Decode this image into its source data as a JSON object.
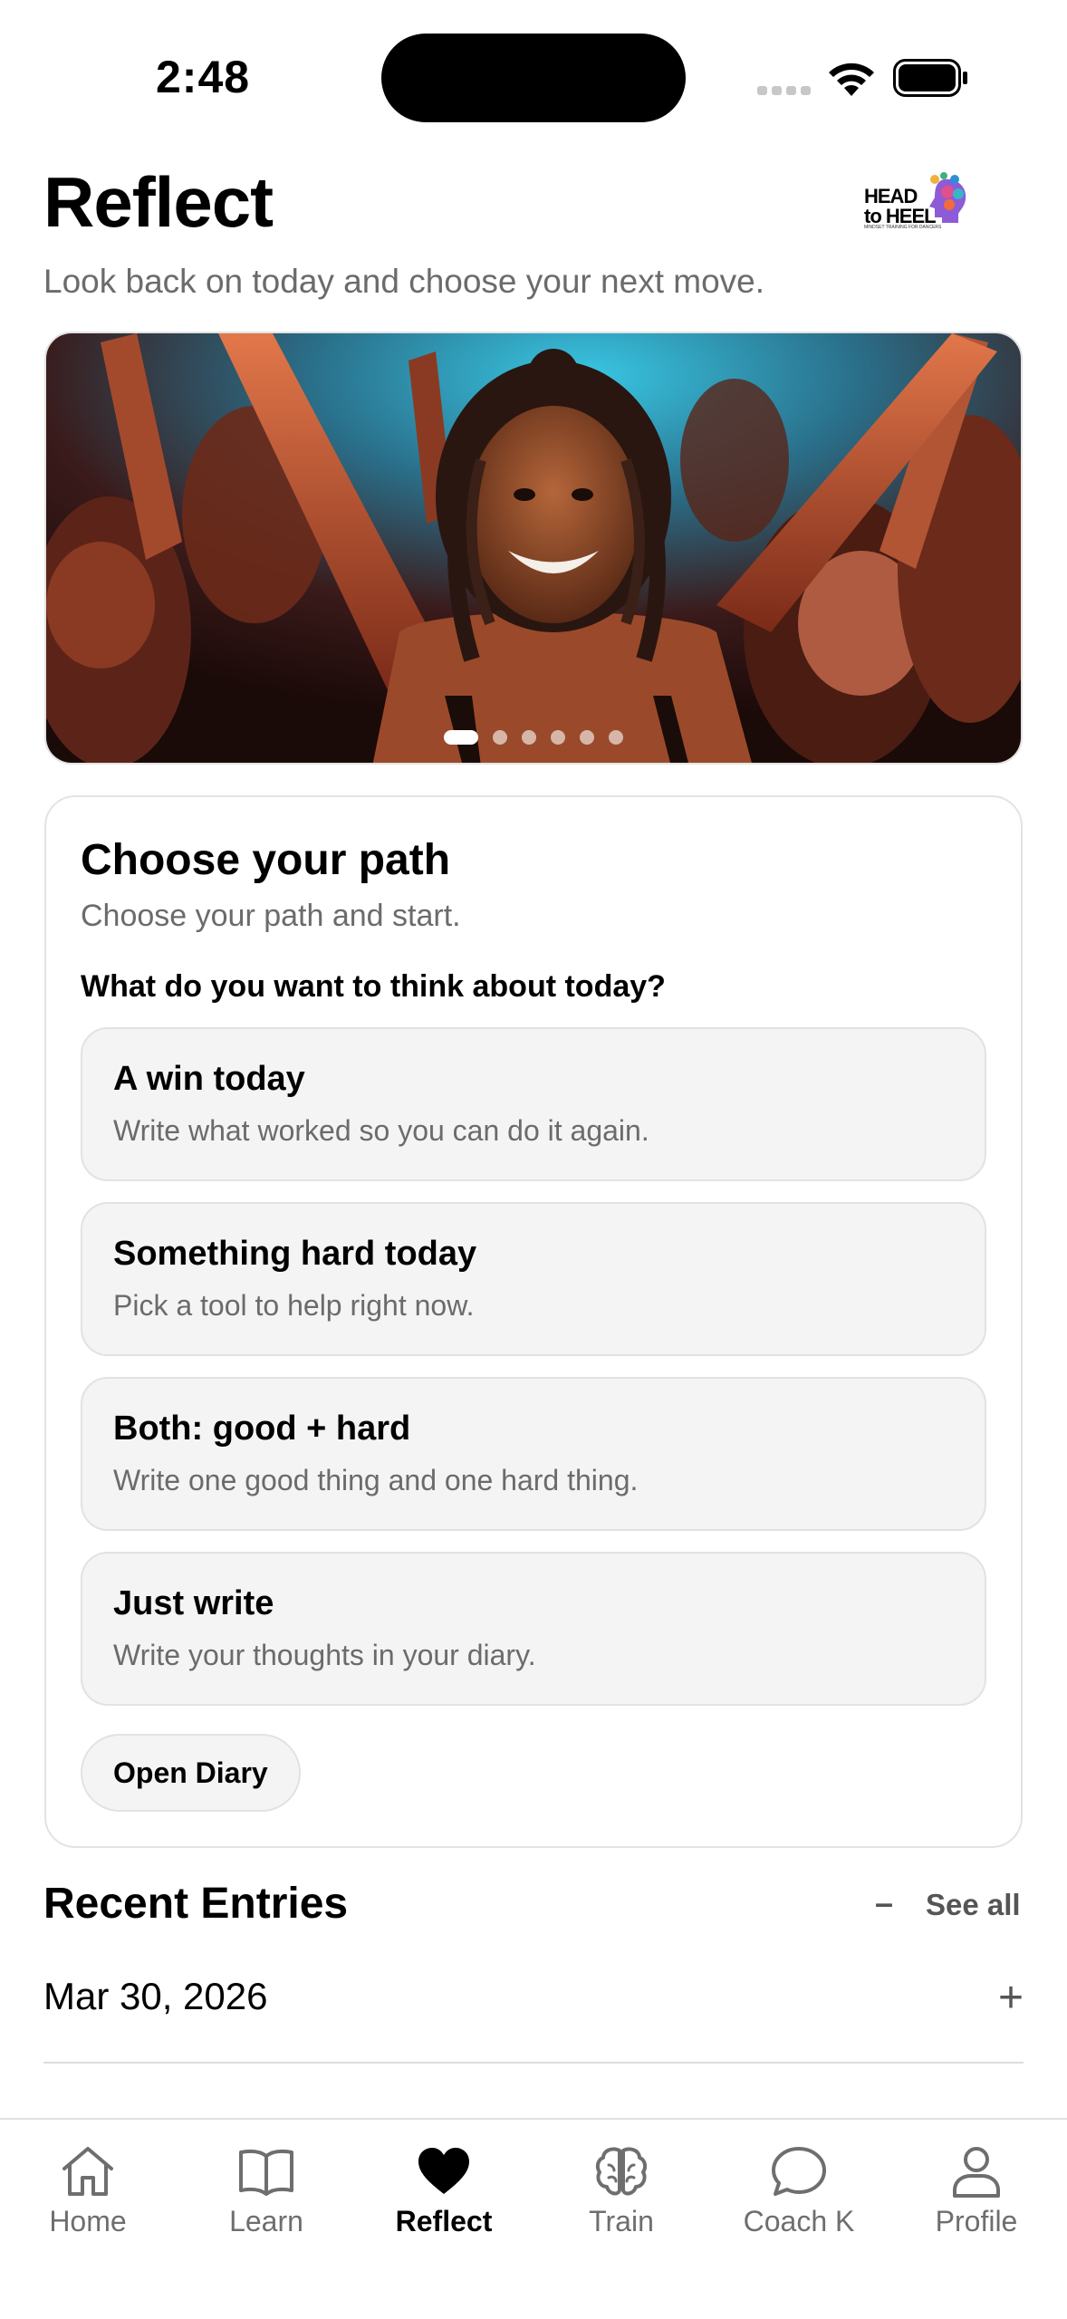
{
  "status_bar": {
    "time": "2:48"
  },
  "header": {
    "title": "Reflect",
    "subtitle": "Look back on today and choose your next move.",
    "logo_text_line1": "HEAD",
    "logo_text_line2": "to HEEL",
    "logo_tagline": "MINDSET TRAINING FOR DANCERS"
  },
  "carousel": {
    "slide_count": 6,
    "active_index": 0
  },
  "path_card": {
    "title": "Choose your path",
    "subtitle": "Choose your path and start.",
    "question": "What do you want to think about today?",
    "options": [
      {
        "title": "A win today",
        "description": "Write what worked so you can do it again."
      },
      {
        "title": "Something hard today",
        "description": "Pick a tool to help right now."
      },
      {
        "title": "Both: good + hard",
        "description": "Write one good thing and one hard thing."
      },
      {
        "title": "Just write",
        "description": "Write your thoughts in your diary."
      }
    ],
    "open_diary_label": "Open Diary"
  },
  "recent_entries": {
    "title": "Recent Entries",
    "collapse_symbol": "–",
    "see_all_label": "See all",
    "entries": [
      {
        "date": "Mar 30, 2026",
        "expand_symbol": "+"
      }
    ]
  },
  "tab_bar": {
    "tabs": [
      {
        "label": "Home",
        "icon": "home-icon"
      },
      {
        "label": "Learn",
        "icon": "book-icon"
      },
      {
        "label": "Reflect",
        "icon": "heart-icon"
      },
      {
        "label": "Train",
        "icon": "brain-icon"
      },
      {
        "label": "Coach K",
        "icon": "chat-bubble-icon"
      },
      {
        "label": "Profile",
        "icon": "person-icon"
      }
    ],
    "active_tab": "Reflect"
  },
  "colors": {
    "text_primary": "#000000",
    "text_secondary": "#6b6b6b",
    "card_fill": "#f4f4f4",
    "border": "#e2e2e2"
  }
}
